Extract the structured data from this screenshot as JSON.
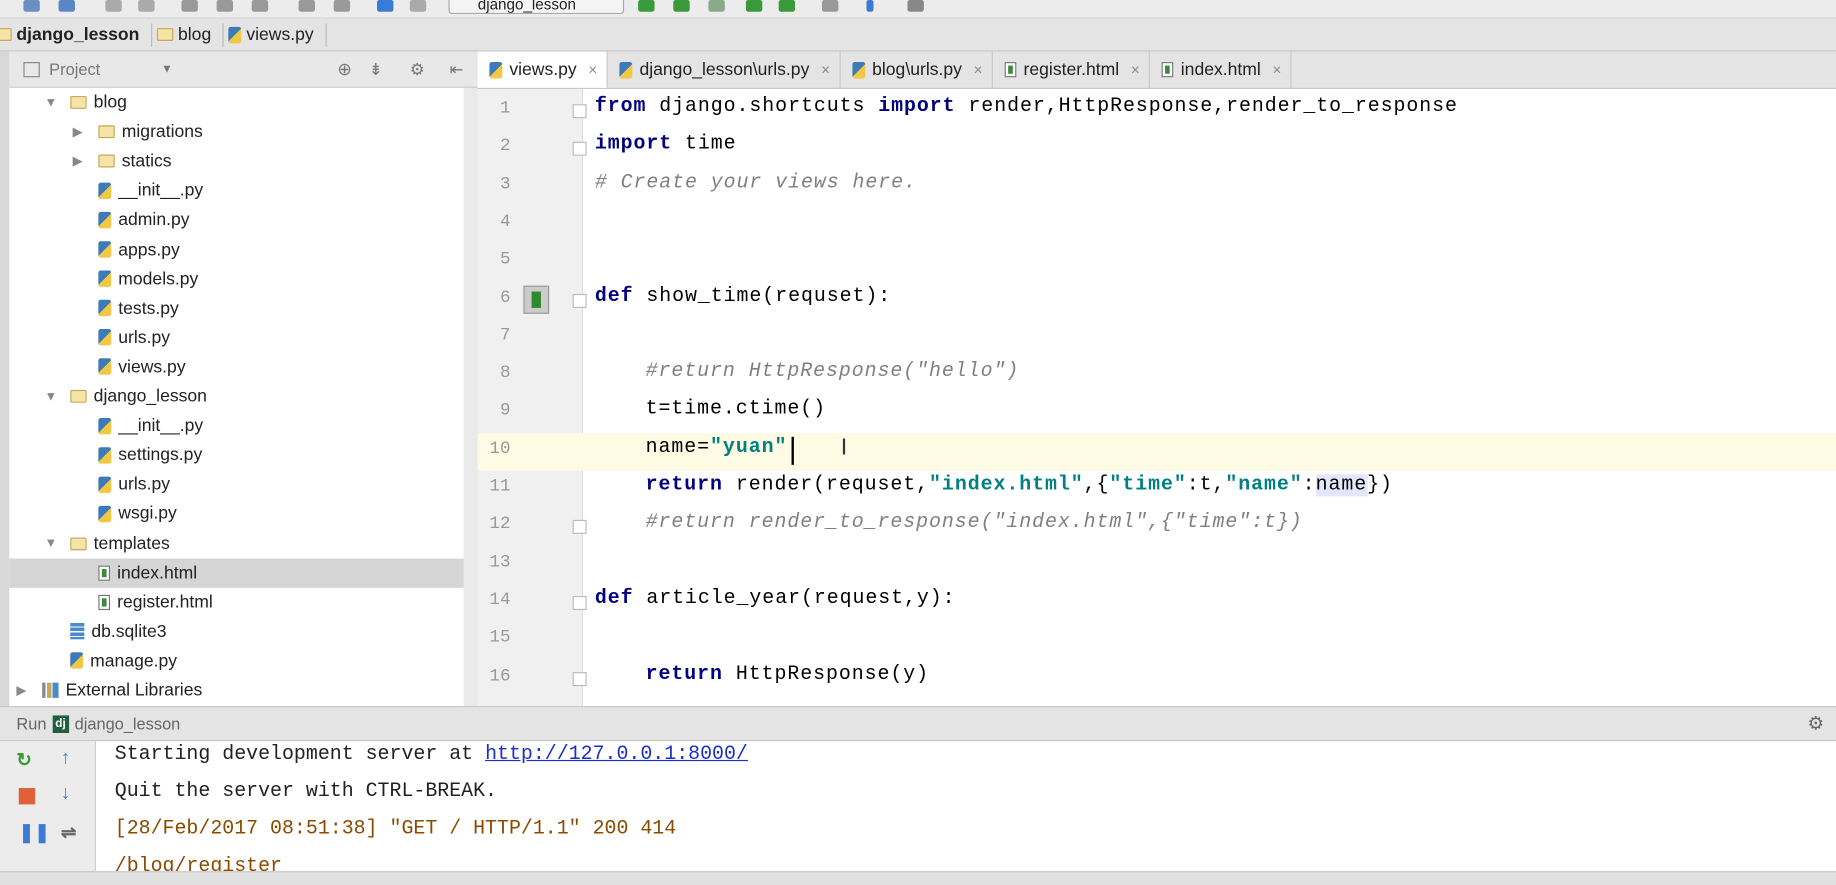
{
  "toolbar": {
    "run_config": "django_lesson"
  },
  "breadcrumb": [
    "django_lesson",
    "blog",
    "views.py"
  ],
  "project_panel": {
    "title": "Project"
  },
  "tree": [
    {
      "label": "blog",
      "icon": "folder",
      "depth": 1,
      "expanded": true
    },
    {
      "label": "migrations",
      "icon": "folder",
      "depth": 2,
      "collapsed": true
    },
    {
      "label": "statics",
      "icon": "folder",
      "depth": 2,
      "collapsed": true
    },
    {
      "label": "__init__.py",
      "icon": "python",
      "depth": 2
    },
    {
      "label": "admin.py",
      "icon": "python",
      "depth": 2
    },
    {
      "label": "apps.py",
      "icon": "python",
      "depth": 2
    },
    {
      "label": "models.py",
      "icon": "python",
      "depth": 2
    },
    {
      "label": "tests.py",
      "icon": "python",
      "depth": 2
    },
    {
      "label": "urls.py",
      "icon": "python",
      "depth": 2
    },
    {
      "label": "views.py",
      "icon": "python",
      "depth": 2
    },
    {
      "label": "django_lesson",
      "icon": "folder",
      "depth": 1,
      "expanded": true
    },
    {
      "label": "__init__.py",
      "icon": "python",
      "depth": 2
    },
    {
      "label": "settings.py",
      "icon": "python",
      "depth": 2
    },
    {
      "label": "urls.py",
      "icon": "python",
      "depth": 2
    },
    {
      "label": "wsgi.py",
      "icon": "python",
      "depth": 2
    },
    {
      "label": "templates",
      "icon": "folder",
      "depth": 1,
      "expanded": true
    },
    {
      "label": "index.html",
      "icon": "html",
      "depth": 2,
      "selected": true
    },
    {
      "label": "register.html",
      "icon": "html",
      "depth": 2
    },
    {
      "label": "db.sqlite3",
      "icon": "database",
      "depth": 1
    },
    {
      "label": "manage.py",
      "icon": "python",
      "depth": 1
    },
    {
      "label": "External Libraries",
      "icon": "library",
      "depth": 0,
      "collapsed": true
    }
  ],
  "tabs": [
    {
      "label": "views.py",
      "icon": "python",
      "active": true
    },
    {
      "label": "django_lesson\\urls.py",
      "icon": "python"
    },
    {
      "label": "blog\\urls.py",
      "icon": "python"
    },
    {
      "label": "register.html",
      "icon": "html"
    },
    {
      "label": "index.html",
      "icon": "html"
    }
  ],
  "editor": {
    "current_line": 10,
    "lines": [
      {
        "n": "1",
        "indent": 0,
        "tokens": [
          {
            "t": "from",
            "c": "kw"
          },
          {
            "t": " django.shortcuts ",
            "c": ""
          },
          {
            "t": "import",
            "c": "kw"
          },
          {
            "t": " render,HttpResponse,render_to_response",
            "c": ""
          }
        ]
      },
      {
        "n": "2",
        "indent": 0,
        "tokens": [
          {
            "t": "import",
            "c": "kw"
          },
          {
            "t": " time",
            "c": ""
          }
        ]
      },
      {
        "n": "3",
        "indent": 0,
        "tokens": [
          {
            "t": "# Create your views here.",
            "c": "cmt"
          }
        ]
      },
      {
        "n": "4",
        "indent": 0,
        "tokens": []
      },
      {
        "n": "5",
        "indent": 0,
        "tokens": []
      },
      {
        "n": "6",
        "indent": 0,
        "tokens": [
          {
            "t": "def",
            "c": "kw"
          },
          {
            "t": " show_time(requset):",
            "c": ""
          }
        ]
      },
      {
        "n": "7",
        "indent": 0,
        "tokens": []
      },
      {
        "n": "8",
        "indent": 4,
        "tokens": [
          {
            "t": "#return HttpResponse(\"hello\")",
            "c": "cmt"
          }
        ]
      },
      {
        "n": "9",
        "indent": 4,
        "tokens": [
          {
            "t": "t=time.ctime()",
            "c": ""
          }
        ]
      },
      {
        "n": "10",
        "indent": 4,
        "tokens": [
          {
            "t": "name=",
            "c": ""
          },
          {
            "t": "\"yuan\"",
            "c": "str"
          }
        ]
      },
      {
        "n": "11",
        "indent": 4,
        "tokens": [
          {
            "t": "return",
            "c": "kw"
          },
          {
            "t": " render(requset,",
            "c": ""
          },
          {
            "t": "\"index.html\"",
            "c": "str"
          },
          {
            "t": ",{",
            "c": ""
          },
          {
            "t": "\"time\"",
            "c": "str"
          },
          {
            "t": ":t,",
            "c": ""
          },
          {
            "t": "\"name\"",
            "c": "str"
          },
          {
            "t": ":",
            "c": ""
          },
          {
            "t": "name",
            "c": "hl"
          },
          {
            "t": "})",
            "c": ""
          }
        ]
      },
      {
        "n": "12",
        "indent": 4,
        "tokens": [
          {
            "t": "#return render_to_response(\"index.html\",{\"time\":t})",
            "c": "cmt"
          }
        ]
      },
      {
        "n": "13",
        "indent": 0,
        "tokens": []
      },
      {
        "n": "14",
        "indent": 0,
        "tokens": [
          {
            "t": "def",
            "c": "kw"
          },
          {
            "t": " article_year(request,y):",
            "c": ""
          }
        ]
      },
      {
        "n": "15",
        "indent": 0,
        "tokens": []
      },
      {
        "n": "16",
        "indent": 4,
        "tokens": [
          {
            "t": "return",
            "c": "kw"
          },
          {
            "t": " HttpResponse(y)",
            "c": ""
          }
        ]
      }
    ]
  },
  "run_panel": {
    "label": "Run",
    "config": "django_lesson"
  },
  "console": {
    "line1_text": "Starting development server at ",
    "line1_link": "http://127.0.0.1:8000/",
    "line2": "Quit the server with CTRL-BREAK.",
    "line3": "[28/Feb/2017 08:51:38] \"GET / HTTP/1.1\" 200 414",
    "line4": "/blog/register"
  }
}
